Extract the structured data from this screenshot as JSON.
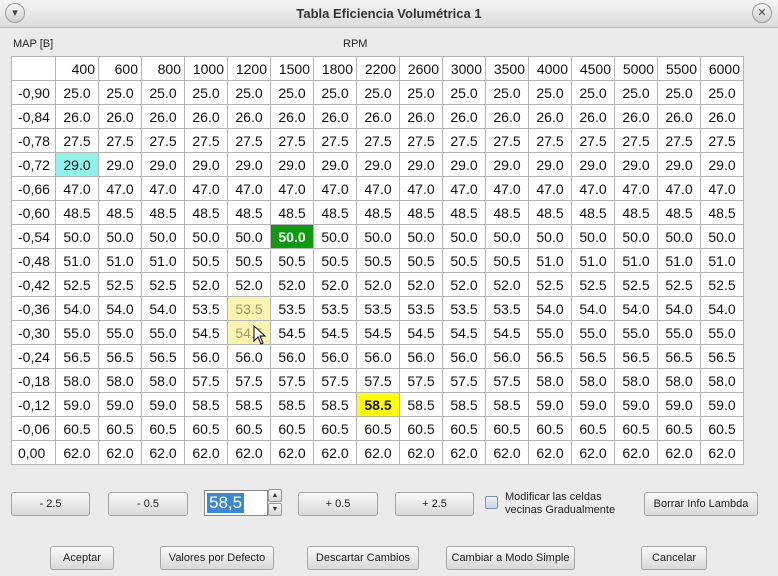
{
  "window": {
    "title": "Tabla Eficiencia Volumétrica 1",
    "menu_icon": "chevron-down-icon",
    "close_icon": "close-icon"
  },
  "labels": {
    "map": "MAP [B]",
    "rpm": "RPM"
  },
  "table": {
    "columns": [
      "400",
      "600",
      "800",
      "1000",
      "1200",
      "1500",
      "1800",
      "2200",
      "2600",
      "3000",
      "3500",
      "4000",
      "4500",
      "5000",
      "5500",
      "6000"
    ],
    "rows": [
      {
        "map": "-0,90",
        "values": [
          "25.0",
          "25.0",
          "25.0",
          "25.0",
          "25.0",
          "25.0",
          "25.0",
          "25.0",
          "25.0",
          "25.0",
          "25.0",
          "25.0",
          "25.0",
          "25.0",
          "25.0",
          "25.0"
        ]
      },
      {
        "map": "-0,84",
        "values": [
          "26.0",
          "26.0",
          "26.0",
          "26.0",
          "26.0",
          "26.0",
          "26.0",
          "26.0",
          "26.0",
          "26.0",
          "26.0",
          "26.0",
          "26.0",
          "26.0",
          "26.0",
          "26.0"
        ]
      },
      {
        "map": "-0,78",
        "values": [
          "27.5",
          "27.5",
          "27.5",
          "27.5",
          "27.5",
          "27.5",
          "27.5",
          "27.5",
          "27.5",
          "27.5",
          "27.5",
          "27.5",
          "27.5",
          "27.5",
          "27.5",
          "27.5"
        ]
      },
      {
        "map": "-0,72",
        "values": [
          "29.0",
          "29.0",
          "29.0",
          "29.0",
          "29.0",
          "29.0",
          "29.0",
          "29.0",
          "29.0",
          "29.0",
          "29.0",
          "29.0",
          "29.0",
          "29.0",
          "29.0",
          "29.0"
        ]
      },
      {
        "map": "-0,66",
        "values": [
          "47.0",
          "47.0",
          "47.0",
          "47.0",
          "47.0",
          "47.0",
          "47.0",
          "47.0",
          "47.0",
          "47.0",
          "47.0",
          "47.0",
          "47.0",
          "47.0",
          "47.0",
          "47.0"
        ]
      },
      {
        "map": "-0,60",
        "values": [
          "48.5",
          "48.5",
          "48.5",
          "48.5",
          "48.5",
          "48.5",
          "48.5",
          "48.5",
          "48.5",
          "48.5",
          "48.5",
          "48.5",
          "48.5",
          "48.5",
          "48.5",
          "48.5"
        ]
      },
      {
        "map": "-0,54",
        "values": [
          "50.0",
          "50.0",
          "50.0",
          "50.0",
          "50.0",
          "50.0",
          "50.0",
          "50.0",
          "50.0",
          "50.0",
          "50.0",
          "50.0",
          "50.0",
          "50.0",
          "50.0",
          "50.0"
        ]
      },
      {
        "map": "-0,48",
        "values": [
          "51.0",
          "51.0",
          "51.0",
          "50.5",
          "50.5",
          "50.5",
          "50.5",
          "50.5",
          "50.5",
          "50.5",
          "50.5",
          "51.0",
          "51.0",
          "51.0",
          "51.0",
          "51.0"
        ]
      },
      {
        "map": "-0,42",
        "values": [
          "52.5",
          "52.5",
          "52.5",
          "52.0",
          "52.0",
          "52.0",
          "52.0",
          "52.0",
          "52.0",
          "52.0",
          "52.0",
          "52.5",
          "52.5",
          "52.5",
          "52.5",
          "52.5"
        ]
      },
      {
        "map": "-0,36",
        "values": [
          "54.0",
          "54.0",
          "54.0",
          "53.5",
          "53.5",
          "53.5",
          "53.5",
          "53.5",
          "53.5",
          "53.5",
          "53.5",
          "54.0",
          "54.0",
          "54.0",
          "54.0",
          "54.0"
        ]
      },
      {
        "map": "-0,30",
        "values": [
          "55.0",
          "55.0",
          "55.0",
          "54.5",
          "54.5",
          "54.5",
          "54.5",
          "54.5",
          "54.5",
          "54.5",
          "54.5",
          "55.0",
          "55.0",
          "55.0",
          "55.0",
          "55.0"
        ]
      },
      {
        "map": "-0,24",
        "values": [
          "56.5",
          "56.5",
          "56.5",
          "56.0",
          "56.0",
          "56.0",
          "56.0",
          "56.0",
          "56.0",
          "56.0",
          "56.0",
          "56.5",
          "56.5",
          "56.5",
          "56.5",
          "56.5"
        ]
      },
      {
        "map": "-0,18",
        "values": [
          "58.0",
          "58.0",
          "58.0",
          "57.5",
          "57.5",
          "57.5",
          "57.5",
          "57.5",
          "57.5",
          "57.5",
          "57.5",
          "58.0",
          "58.0",
          "58.0",
          "58.0",
          "58.0"
        ]
      },
      {
        "map": "-0,12",
        "values": [
          "59.0",
          "59.0",
          "59.0",
          "58.5",
          "58.5",
          "58.5",
          "58.5",
          "58.5",
          "58.5",
          "58.5",
          "58.5",
          "59.0",
          "59.0",
          "59.0",
          "59.0",
          "59.0"
        ]
      },
      {
        "map": "-0,06",
        "values": [
          "60.5",
          "60.5",
          "60.5",
          "60.5",
          "60.5",
          "60.5",
          "60.5",
          "60.5",
          "60.5",
          "60.5",
          "60.5",
          "60.5",
          "60.5",
          "60.5",
          "60.5",
          "60.5"
        ]
      },
      {
        "map": "0,00",
        "values": [
          "62.0",
          "62.0",
          "62.0",
          "62.0",
          "62.0",
          "62.0",
          "62.0",
          "62.0",
          "62.0",
          "62.0",
          "62.0",
          "62.0",
          "62.0",
          "62.0",
          "62.0",
          "62.0"
        ]
      }
    ],
    "highlights": [
      {
        "row": 3,
        "col": 0,
        "style": "cyan"
      },
      {
        "row": 6,
        "col": 5,
        "style": "green"
      },
      {
        "row": 13,
        "col": 7,
        "style": "yellow"
      },
      {
        "row": 9,
        "col": 4,
        "style": "faint"
      },
      {
        "row": 10,
        "col": 4,
        "style": "faint"
      }
    ]
  },
  "controls": {
    "minus_2_5": "- 2.5",
    "minus_0_5": "- 0.5",
    "value": "58,5",
    "plus_0_5": "+ 0.5",
    "plus_2_5": "+ 2.5",
    "spin_up_icon": "spin-up-icon",
    "spin_down_icon": "spin-down-icon",
    "checkbox_line1": "Modificar las celdas",
    "checkbox_line2": "vecinas Gradualmente",
    "borrar": "Borrar Info Lambda"
  },
  "footer": {
    "aceptar": "Aceptar",
    "defecto": "Valores por Defecto",
    "descartar": "Descartar Cambios",
    "modo_simple": "Cambiar a Modo Simple",
    "cancelar": "Cancelar"
  },
  "colors": {
    "cyan": "#8ff3ec",
    "green": "#0f9b10",
    "yellow": "#ffff00",
    "selection": "#3b87d6"
  }
}
